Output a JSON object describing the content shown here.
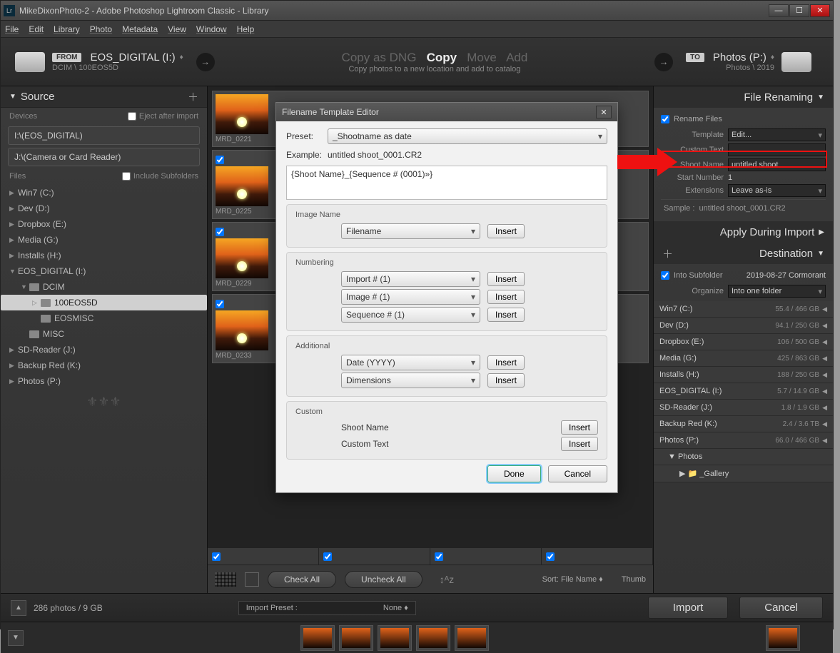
{
  "titlebar": "MikeDixonPhoto-2 - Adobe Photoshop Lightroom Classic - Library",
  "menu": [
    "File",
    "Edit",
    "Library",
    "Photo",
    "Metadata",
    "View",
    "Window",
    "Help"
  ],
  "importbar": {
    "from_badge": "FROM",
    "from_drive": "EOS_DIGITAL (I:)",
    "from_sub": "DCIM \\ 100EOS5D",
    "mode_dng": "Copy as DNG",
    "mode_copy": "Copy",
    "mode_move": "Move",
    "mode_add": "Add",
    "sub": "Copy photos to a new location and add to catalog",
    "to_badge": "TO",
    "to_drive": "Photos (P:)",
    "to_sub": "Photos \\ 2019"
  },
  "source": {
    "title": "Source",
    "devices_label": "Devices",
    "eject_label": "Eject after import",
    "dev1": "I:\\(EOS_DIGITAL)",
    "dev2": "J:\\(Camera or Card Reader)",
    "files_label": "Files",
    "include_sub": "Include Subfolders",
    "drives": [
      {
        "name": "Win7 (C:)"
      },
      {
        "name": "Dev (D:)"
      },
      {
        "name": "Dropbox (E:)"
      },
      {
        "name": "Media (G:)"
      },
      {
        "name": "Installs (H:)"
      },
      {
        "name": "EOS_DIGITAL (I:)",
        "expanded": true
      },
      {
        "name": "SD-Reader (J:)"
      },
      {
        "name": "Backup Red (K:)"
      },
      {
        "name": "Photos (P:)"
      }
    ],
    "sub_dcim": "DCIM",
    "sub_100": "100EOS5D",
    "sub_eosmisc": "EOSMISC",
    "sub_misc": "MISC"
  },
  "thumbs": [
    "MRD_0221",
    "MRD_0225",
    "MRD_0229",
    "MRD_0233"
  ],
  "mid_toolbar": {
    "check_all": "Check All",
    "uncheck_all": "Uncheck All",
    "sort_label": "Sort:",
    "sort_value": "File Name",
    "thumb_label": "Thumb"
  },
  "file_renaming": {
    "title": "File Renaming",
    "rename_files": "Rename Files",
    "template_label": "Template",
    "template_value": "Edit...",
    "custom_text_label": "Custom Text",
    "custom_text_value": "",
    "shoot_name_label": "Shoot Name",
    "shoot_name_value": "untitled shoot",
    "start_number_label": "Start Number",
    "start_number_value": "1",
    "extensions_label": "Extensions",
    "extensions_value": "Leave as-is",
    "sample_label": "Sample :",
    "sample_value": "untitled shoot_0001.CR2"
  },
  "apply_during": "Apply During Import",
  "destination": {
    "title": "Destination",
    "into_subfolder": "Into Subfolder",
    "subfolder_value": "2019-08-27 Cormorant",
    "organize_label": "Organize",
    "organize_value": "Into one folder",
    "drives": [
      {
        "name": "Win7 (C:)",
        "size": "55.4 / 466 GB"
      },
      {
        "name": "Dev (D:)",
        "size": "94.1 / 250 GB"
      },
      {
        "name": "Dropbox (E:)",
        "size": "106 / 500 GB"
      },
      {
        "name": "Media (G:)",
        "size": "425 / 863 GB"
      },
      {
        "name": "Installs (H:)",
        "size": "188 / 250 GB"
      },
      {
        "name": "EOS_DIGITAL (I:)",
        "size": "5.7 / 14.9 GB"
      },
      {
        "name": "SD-Reader (J:)",
        "size": "1.8 / 1.9 GB"
      },
      {
        "name": "Backup Red (K:)",
        "size": "2.4 / 3.6 TB"
      },
      {
        "name": "Photos (P:)",
        "size": "66.0 / 466 GB"
      }
    ],
    "sub_photos": "Photos",
    "sub_gallery": "_Gallery"
  },
  "bottombar": {
    "status": "286 photos / 9 GB",
    "preset_label": "Import Preset :",
    "preset_value": "None",
    "import": "Import",
    "cancel": "Cancel"
  },
  "dialog": {
    "title": "Filename Template Editor",
    "preset_label": "Preset:",
    "preset_value": "_Shootname as date",
    "example_label": "Example:",
    "example_value": "untitled shoot_0001.CR2",
    "pattern": "{Shoot Name}_{Sequence # (0001)»}",
    "sec_image": "Image Name",
    "image_filename": "Filename",
    "sec_numbering": "Numbering",
    "num_import": "Import # (1)",
    "num_image": "Image # (1)",
    "num_seq": "Sequence # (1)",
    "sec_additional": "Additional",
    "add_date": "Date (YYYY)",
    "add_dim": "Dimensions",
    "sec_custom": "Custom",
    "custom_shoot": "Shoot Name",
    "custom_text": "Custom Text",
    "insert": "Insert",
    "done": "Done",
    "cancel": "Cancel"
  }
}
